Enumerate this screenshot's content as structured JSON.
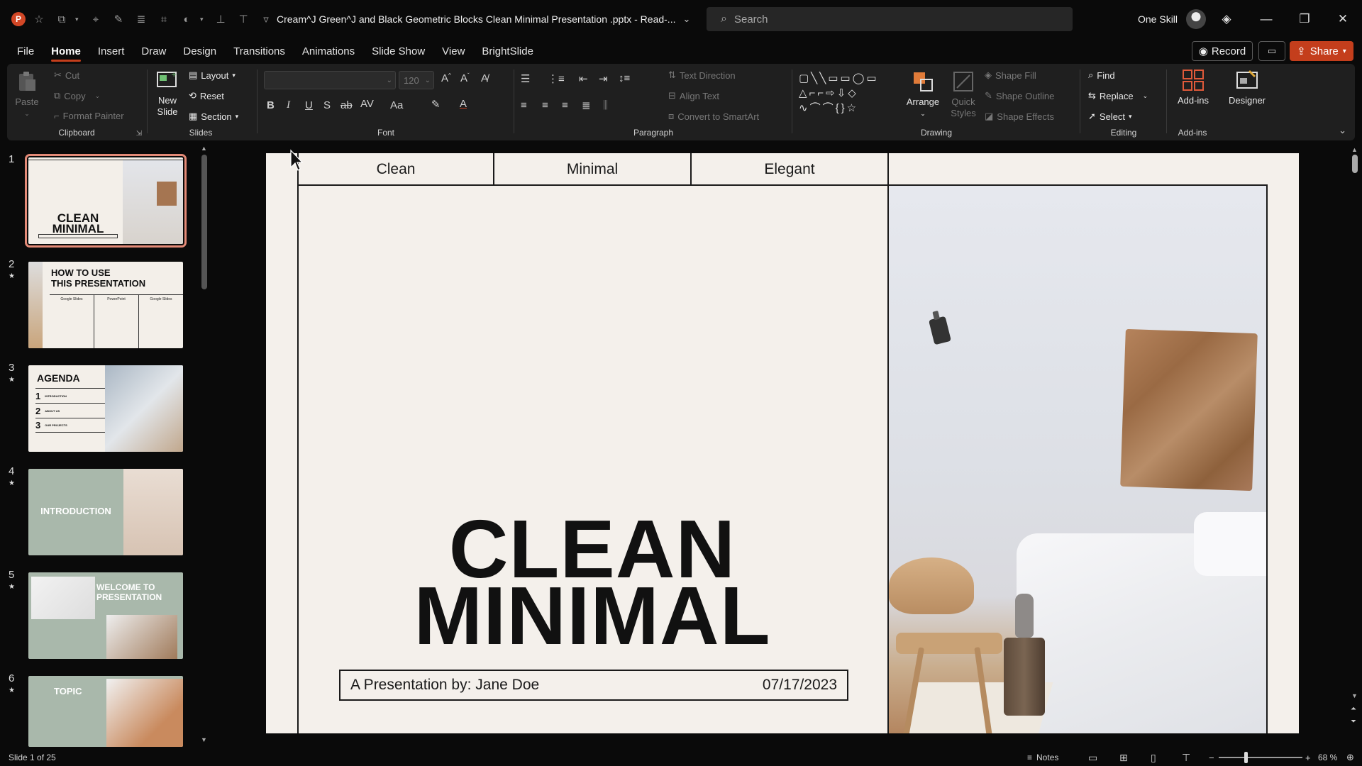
{
  "window": {
    "doc_title": "Cream^J Green^J and Black Geometric Blocks Clean Minimal Presentation .pptx  -  Read-...",
    "search_placeholder": "Search",
    "user_name": "One Skill",
    "app_letter": "P"
  },
  "tabs": [
    "File",
    "Home",
    "Insert",
    "Draw",
    "Design",
    "Transitions",
    "Animations",
    "Slide Show",
    "View",
    "BrightSlide"
  ],
  "active_tab": "Home",
  "actions": {
    "record": "Record",
    "share": "Share"
  },
  "ribbon": {
    "clipboard": {
      "label": "Clipboard",
      "paste": "Paste",
      "cut": "Cut",
      "copy": "Copy",
      "format_painter": "Format Painter"
    },
    "slides": {
      "label": "Slides",
      "new_slide_line1": "New",
      "new_slide_line2": "Slide",
      "layout": "Layout",
      "reset": "Reset",
      "section": "Section"
    },
    "font": {
      "label": "Font",
      "size": "120"
    },
    "paragraph": {
      "label": "Paragraph",
      "text_direction": "Text Direction",
      "align_text": "Align Text",
      "convert_smartart": "Convert to SmartArt"
    },
    "drawing": {
      "label": "Drawing",
      "arrange": "Arrange",
      "quick_styles_line1": "Quick",
      "quick_styles_line2": "Styles",
      "shape_fill": "Shape Fill",
      "shape_outline": "Shape Outline",
      "shape_effects": "Shape Effects"
    },
    "editing": {
      "label": "Editing",
      "find": "Find",
      "replace": "Replace",
      "select": "Select"
    },
    "addins": {
      "label": "Add-ins",
      "addins_btn": "Add-ins",
      "designer": "Designer"
    }
  },
  "thumbnails": [
    {
      "num": "1",
      "star": "",
      "title_line1": "CLEAN",
      "title_line2": "MINIMAL"
    },
    {
      "num": "2",
      "star": "★",
      "title_line1": "HOW TO USE",
      "title_line2": "THIS PRESENTATION",
      "cols": [
        "Google Slides",
        "PowerPoint",
        "Google Slides"
      ]
    },
    {
      "num": "3",
      "star": "★",
      "title_line1": "AGENDA",
      "items": [
        "1",
        "2",
        "3"
      ],
      "item_labels": [
        "INTRODUCTION",
        "ABOUT US",
        "OUR PROJECTS"
      ]
    },
    {
      "num": "4",
      "star": "★",
      "title_line1": "INTRODUCTION"
    },
    {
      "num": "5",
      "star": "★",
      "title_line1": "WELCOME TO",
      "title_line2": "PRESENTATION"
    },
    {
      "num": "6",
      "star": "★",
      "title_line1": "TOPIC"
    }
  ],
  "slide": {
    "header_cells": [
      "Clean",
      "Minimal",
      "Elegant"
    ],
    "title_line1": "CLEAN",
    "title_line2": "MINIMAL",
    "byline": "A Presentation by: Jane Doe",
    "date": "07/17/2023"
  },
  "statusbar": {
    "slide_counter": "Slide 1 of 25",
    "notes": "Notes",
    "zoom": "68 %"
  },
  "colors": {
    "accent": "#c43e1c",
    "slide_bg": "#f4f0eb",
    "ribbon_bg": "#1f1f1f",
    "selected_thumb": "#e38a77"
  }
}
